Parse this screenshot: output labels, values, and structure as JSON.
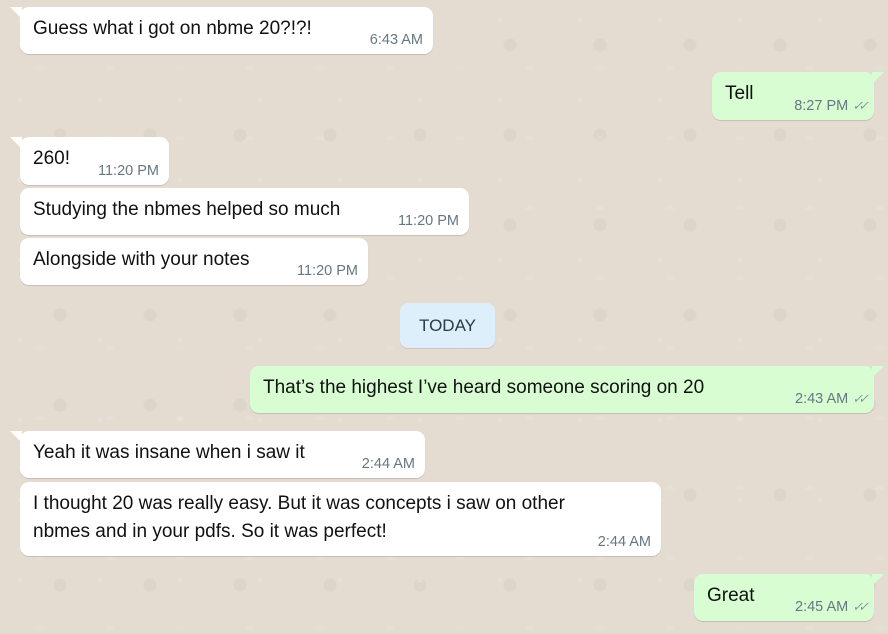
{
  "conversation": {
    "day_divider": "TODAY",
    "messages": [
      {
        "id": "m1",
        "direction": "in",
        "text": "Guess what i got on nbme 20?!?!",
        "time": "6:43 AM"
      },
      {
        "id": "m2",
        "direction": "out",
        "text": "Tell",
        "time": "8:27 PM",
        "status": "read"
      },
      {
        "id": "m3",
        "direction": "in",
        "text": "260!",
        "time": "11:20 PM"
      },
      {
        "id": "m4",
        "direction": "in",
        "text": "Studying the nbmes helped so much",
        "time": "11:20 PM"
      },
      {
        "id": "m5",
        "direction": "in",
        "text": "Alongside with your notes",
        "time": "11:20 PM"
      },
      {
        "id": "m6",
        "direction": "out",
        "text": "That’s the highest I’ve heard someone scoring on 20",
        "time": "2:43 AM",
        "status": "read"
      },
      {
        "id": "m7",
        "direction": "in",
        "text": "Yeah it was insane when i saw it",
        "time": "2:44 AM"
      },
      {
        "id": "m8",
        "direction": "in",
        "text": "I thought 20 was really easy. But it was concepts i saw on other\nnbmes and in your pdfs. So it was perfect!",
        "time": "2:44 AM"
      },
      {
        "id": "m9",
        "direction": "out",
        "text": "Great",
        "time": "2:45 AM",
        "status": "read"
      }
    ]
  },
  "icons": {
    "read_receipt": "double-check-icon"
  },
  "colors": {
    "incoming": "#ffffff",
    "outgoing": "#d9fdd3",
    "background": "#e4dbd1",
    "day_pill": "#dceffa",
    "timestamp": "#667781"
  }
}
